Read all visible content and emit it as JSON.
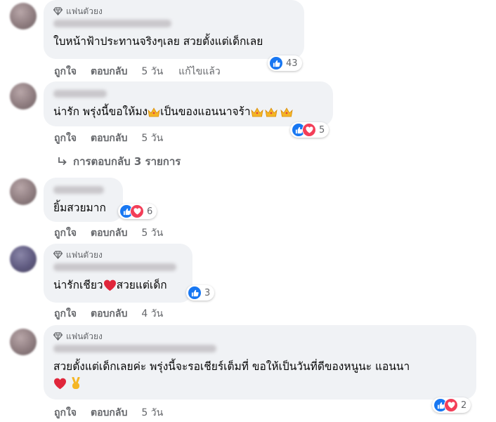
{
  "comments": [
    {
      "badge": "แฟนตัวยง",
      "text": "ใบหน้าฟ้าประทานจริงๆเลย สวยตั้งแต่เด็กเลย",
      "like": "ถูกใจ",
      "reply": "ตอบกลับ",
      "time": "5 วัน",
      "edited": "แก้ไขแล้ว",
      "reaction_count": "43",
      "reactions": [
        "like"
      ]
    },
    {
      "text_a": "น่ารัก พรุ่งนี้ขอให้มง",
      "text_b": "เป็นของแอนนาจร้า",
      "like": "ถูกใจ",
      "reply": "ตอบกลับ",
      "time": "5 วัน",
      "reaction_count": "5",
      "reactions": [
        "like",
        "love"
      ],
      "replies_label": "การตอบกลับ 3 รายการ"
    },
    {
      "text": "ยิ้มสวยมาก",
      "like": "ถูกใจ",
      "reply": "ตอบกลับ",
      "time": "5 วัน",
      "reaction_count": "6",
      "reactions": [
        "like",
        "love"
      ]
    },
    {
      "badge": "แฟนตัวยง",
      "text_a": "น่ารักเชียว",
      "text_b": "สวยแต่เด็ก",
      "like": "ถูกใจ",
      "reply": "ตอบกลับ",
      "time": "4 วัน",
      "reaction_count": "3",
      "reactions": [
        "like"
      ]
    },
    {
      "badge": "แฟนตัวยง",
      "text": "สวยตั้งแต่เด็กเลยค่ะ พรุ่งนี้จะรอเชียร์เต็มที่ ขอให้เป็นวันที่ดีของหนูนะ แอนนา",
      "like": "ถูกใจ",
      "reply": "ตอบกลับ",
      "time": "5 วัน",
      "reaction_count": "2",
      "reactions": [
        "like",
        "love"
      ]
    }
  ],
  "colors": {
    "like": "#1877f2",
    "love": "#f33e58",
    "bubble": "#f0f2f5",
    "meta": "#65676b"
  },
  "icons": [
    "diamond-icon",
    "like-icon",
    "love-icon",
    "crown-emoji",
    "heart-emoji",
    "victory-hand-emoji",
    "reply-arrow-icon"
  ]
}
